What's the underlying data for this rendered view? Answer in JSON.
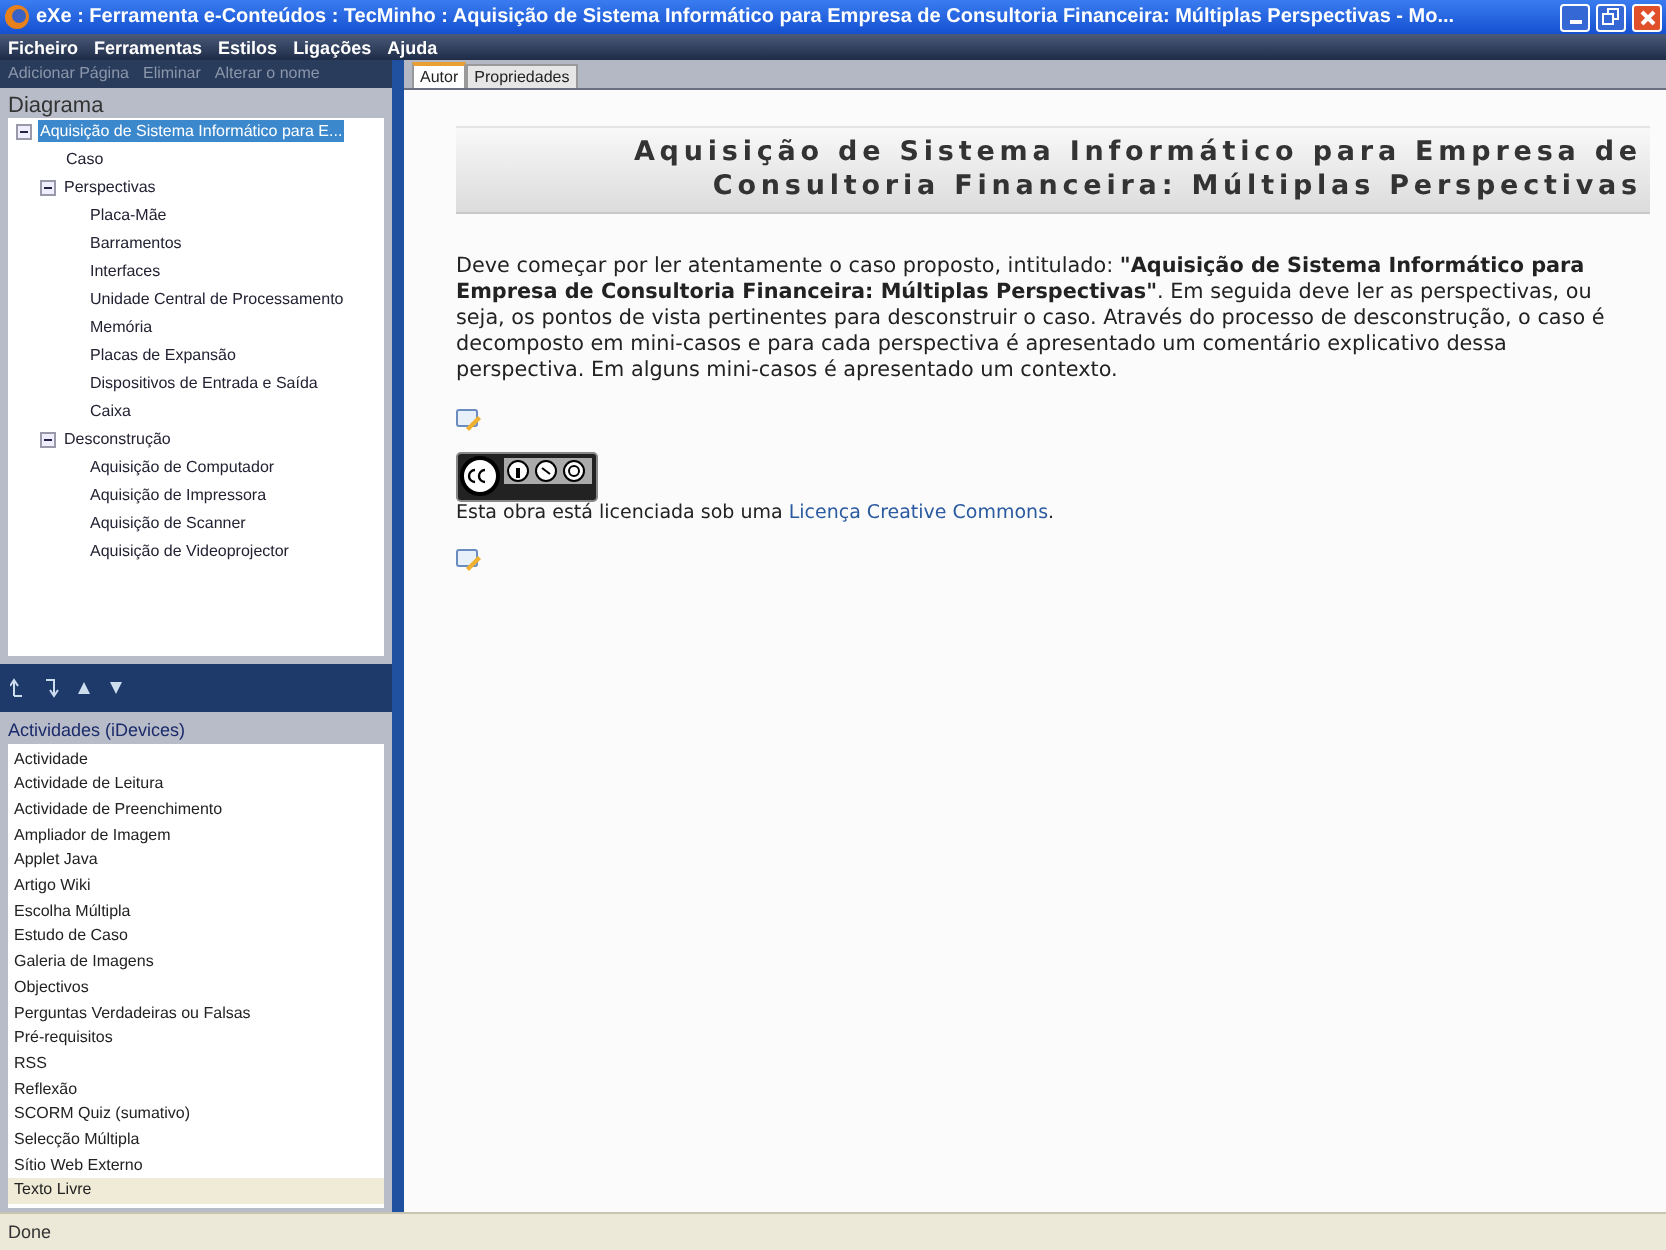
{
  "window": {
    "title": "eXe : Ferramenta e-Conteúdos : TecMinho : Aquisição de Sistema Informático para Empresa de Consultoria Financeira: Múltiplas Perspectivas - Mo..."
  },
  "menu": [
    "Ficheiro",
    "Ferramentas",
    "Estilos",
    "Ligações",
    "Ajuda"
  ],
  "outline_toolbar": [
    {
      "label": "Adicionar Página",
      "disabled": true
    },
    {
      "label": "Eliminar",
      "disabled": true
    },
    {
      "label": "Alterar o nome",
      "disabled": true
    }
  ],
  "outline": {
    "title": "Diagrama",
    "items": [
      {
        "label": "Aquisição de Sistema Informático para E...",
        "selected": true,
        "expanded": true,
        "children": [
          {
            "label": "Caso",
            "selected": false
          },
          {
            "label": "Perspectivas",
            "selected": false,
            "expanded": true,
            "children": [
              {
                "label": "Placa-Mãe",
                "selected": false
              },
              {
                "label": "Barramentos",
                "selected": false
              },
              {
                "label": "Interfaces",
                "selected": false
              },
              {
                "label": "Unidade Central de Processamento",
                "selected": false
              },
              {
                "label": "Memória",
                "selected": false
              },
              {
                "label": "Placas de Expansão",
                "selected": false
              },
              {
                "label": "Dispositivos de Entrada e Saída",
                "selected": false
              },
              {
                "label": "Caixa",
                "selected": false
              }
            ]
          },
          {
            "label": "Desconstrução",
            "selected": false,
            "expanded": true,
            "children": [
              {
                "label": "Aquisição de Computador",
                "selected": false
              },
              {
                "label": "Aquisição de Impressora",
                "selected": false
              },
              {
                "label": "Aquisição de Scanner",
                "selected": false
              },
              {
                "label": "Aquisição de Videoprojector",
                "selected": false
              }
            ]
          }
        ]
      }
    ]
  },
  "idevices": {
    "title": "Actividades (iDevices)",
    "items": [
      {
        "label": "Actividade",
        "selected": false
      },
      {
        "label": "Actividade de Leitura",
        "selected": false
      },
      {
        "label": "Actividade de Preenchimento",
        "selected": false
      },
      {
        "label": "Ampliador de Imagem",
        "selected": false
      },
      {
        "label": "Applet Java",
        "selected": false
      },
      {
        "label": "Artigo Wiki",
        "selected": false
      },
      {
        "label": "Escolha Múltipla",
        "selected": false
      },
      {
        "label": "Estudo de Caso",
        "selected": false
      },
      {
        "label": "Galeria de Imagens",
        "selected": false
      },
      {
        "label": "Objectivos",
        "selected": false
      },
      {
        "label": "Perguntas Verdadeiras ou Falsas",
        "selected": false
      },
      {
        "label": "Pré-requisitos",
        "selected": false
      },
      {
        "label": "RSS",
        "selected": false
      },
      {
        "label": "Reflexão",
        "selected": false
      },
      {
        "label": "SCORM Quiz (sumativo)",
        "selected": false
      },
      {
        "label": "Selecção Múltipla",
        "selected": false
      },
      {
        "label": "Sítio Web Externo",
        "selected": false
      },
      {
        "label": "Texto Livre",
        "selected": true
      }
    ]
  },
  "tabs": [
    {
      "label": "Autor",
      "selected": true
    },
    {
      "label": "Propriedades",
      "selected": false
    }
  ],
  "content": {
    "heading": "Aquisição de Sistema Informático para Empresa de Consultoria Financeira: Múltiplas Perspectivas",
    "paragraph": "Deve começar por ler atentamente o caso proposto, intitulado: **\"Aquisição de Sistema Informático para Empresa de Consultoria Financeira: Múltiplas Perspectivas\"**. Em seguida deve ler as perspectivas, ou seja, os pontos de vista pertinentes para desconstruir o caso. Através do processo de desconstrução, o caso é decomposto em mini-casos e para cada perspectiva é apresentado um comentário explicativo dessa perspectiva. Em alguns mini-casos é apresentado um contexto.",
    "license_text": "Esta obra está licenciada sob uma",
    "license_link": "Licença Creative Commons",
    "license_end": "."
  },
  "status_bar": "Done"
}
